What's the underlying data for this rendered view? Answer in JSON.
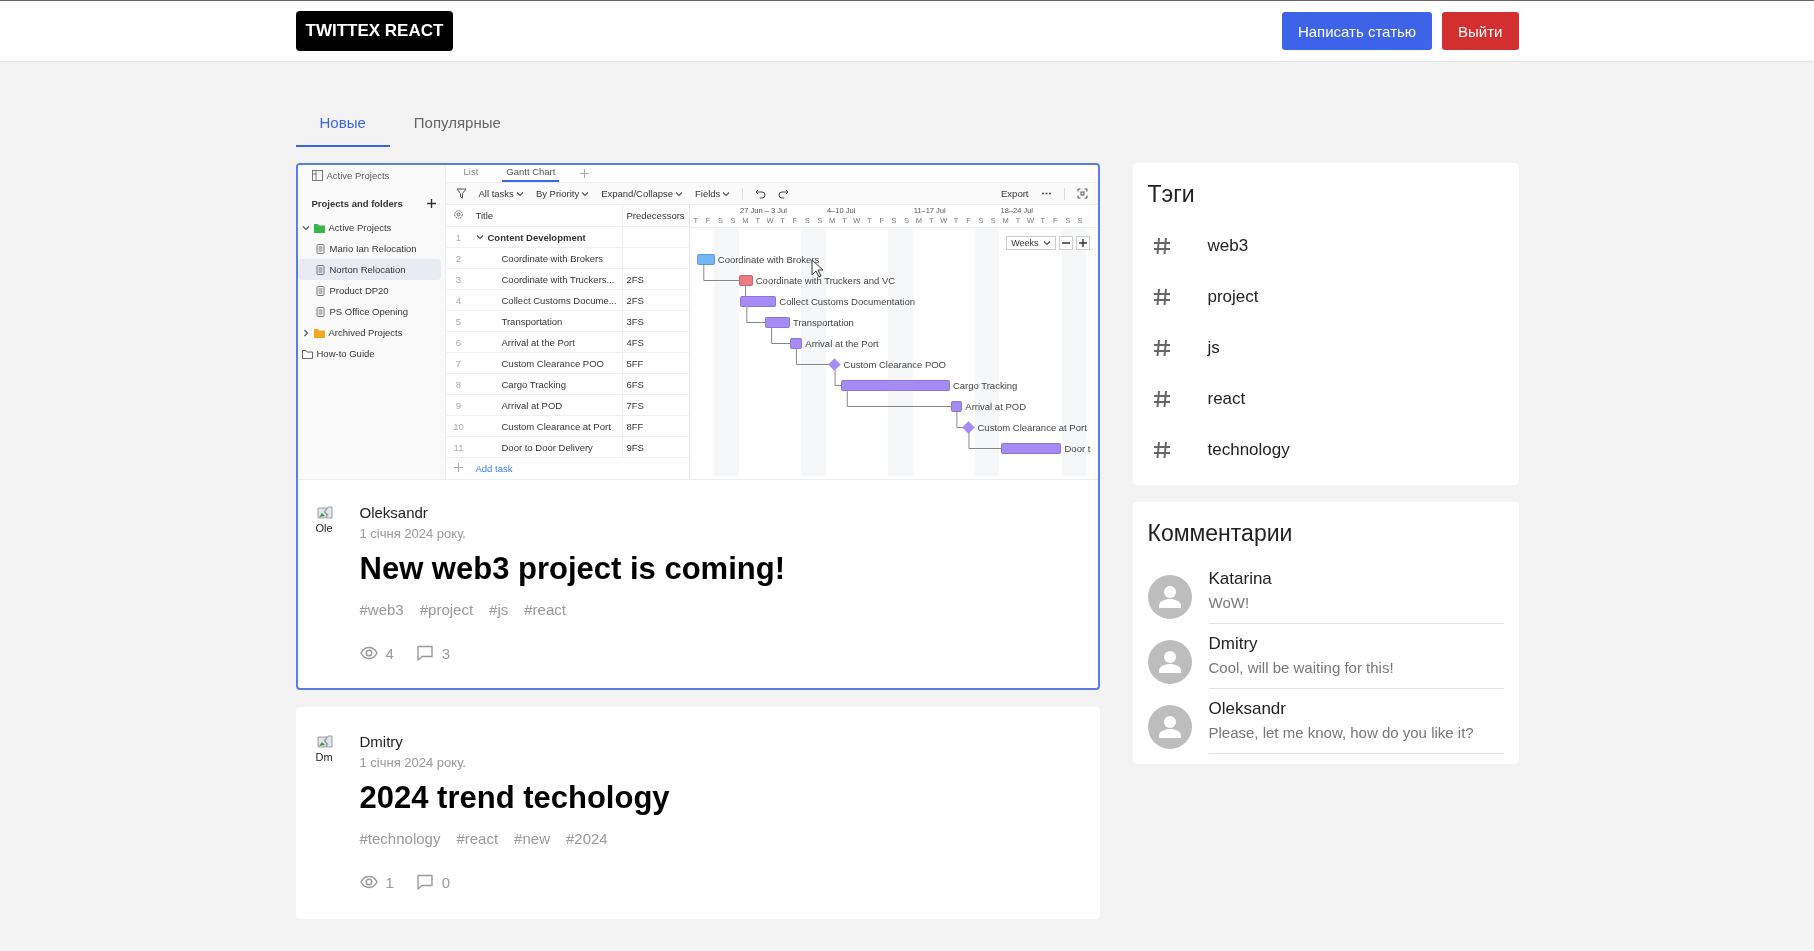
{
  "header": {
    "logo": "TWITTEX REACT",
    "buttons": [
      {
        "label": "Написать статью",
        "kind": "primary"
      },
      {
        "label": "Выйти",
        "kind": "danger"
      }
    ]
  },
  "tabs": [
    {
      "label": "Новые",
      "selected": true
    },
    {
      "label": "Популярные",
      "selected": false
    }
  ],
  "posts": [
    {
      "selected": true,
      "avatar_alt": "Ole",
      "author": "Oleksandr",
      "date": "1 січня 2024 року.",
      "title": "New web3 project is coming!",
      "tags": [
        "#web3",
        "#project",
        "#js",
        "#react"
      ],
      "views": "4",
      "comments": "3",
      "image": {
        "kind": "gantt-screenshot",
        "project_title": "Active Projects",
        "view_tabs": [
          {
            "label": "List",
            "selected": false
          },
          {
            "label": "Gantt Chart",
            "selected": true
          }
        ],
        "sidebar": {
          "title": "Projects and folders",
          "items": [
            {
              "label": "Active Projects",
              "kind": "folder",
              "color": "#3cb64a",
              "expanded": true,
              "selected": false,
              "children": [
                {
                  "label": "Mario Ian Relocation",
                  "kind": "project",
                  "selected": false
                },
                {
                  "label": "Norton Relocation",
                  "kind": "project",
                  "selected": true
                },
                {
                  "label": "Product DP20",
                  "kind": "project",
                  "selected": false
                },
                {
                  "label": "PS Office Opening",
                  "kind": "project",
                  "selected": false
                }
              ]
            },
            {
              "label": "Archived Projects",
              "kind": "folder",
              "color": "#f5a623",
              "expanded": false,
              "selected": false
            },
            {
              "label": "How-to Guide",
              "kind": "plain-folder",
              "selected": false
            }
          ]
        },
        "toolbar": [
          "All tasks",
          "By Priority",
          "Expand/Collapse",
          "Fields"
        ],
        "export": "Export",
        "columns": [
          "Title",
          "Predecessors"
        ],
        "tasks": [
          {
            "number": "1",
            "title": "Content Development",
            "kind": "group",
            "expanded": true
          },
          {
            "number": "2",
            "title": "Coordinate with Brokers",
            "kind": "task",
            "bar": {
              "kind": "task",
              "color": "#74b6fb",
              "label": "Coordinate with Brokers"
            }
          },
          {
            "number": "3",
            "title": "Coordinate with Truckers...",
            "predecessors": "2FS",
            "kind": "task",
            "bar": {
              "kind": "task",
              "color": "#ec7a80",
              "label": "Coordinate with Truckers and VC"
            }
          },
          {
            "number": "4",
            "title": "Collect Customs Docume...",
            "predecessors": "2FS",
            "kind": "task",
            "bar": {
              "kind": "task",
              "color": "#a68bf5",
              "label": "Collect Customs Documentation"
            }
          },
          {
            "number": "5",
            "title": "Transportation",
            "predecessors": "3FS",
            "kind": "task",
            "bar": {
              "kind": "task",
              "color": "#a68bf5",
              "label": "Transportation"
            }
          },
          {
            "number": "6",
            "title": "Arrival at the Port",
            "predecessors": "4FS",
            "kind": "task",
            "bar": {
              "kind": "task",
              "color": "#a68bf5",
              "label": "Arrival at the Port"
            }
          },
          {
            "number": "7",
            "title": "Custom Clearance POO",
            "predecessors": "5FF",
            "kind": "task",
            "bar": {
              "kind": "milestone",
              "color": "#a68bf5",
              "label": "Custom Clearance POO"
            }
          },
          {
            "number": "8",
            "title": "Cargo Tracking",
            "predecessors": "6FS",
            "kind": "task",
            "bar": {
              "kind": "task",
              "color": "#a68bf5",
              "label": "Cargo Tracking"
            }
          },
          {
            "number": "9",
            "title": "Arrival at POD",
            "predecessors": "7FS",
            "kind": "task",
            "bar": {
              "kind": "task",
              "color": "#a68bf5",
              "label": "Arrival at POD"
            }
          },
          {
            "number": "10",
            "title": "Custom Clearance at Port",
            "predecessors": "8FF",
            "kind": "task",
            "bar": {
              "kind": "milestone",
              "color": "#a68bf5",
              "label": "Custom Clearance at Port"
            }
          },
          {
            "number": "11",
            "title": "Door to Door Delivery",
            "predecessors": "9FS",
            "kind": "task",
            "bar": {
              "kind": "task",
              "color": "#a68bf5",
              "label": "Door t"
            }
          }
        ],
        "add_task": "Add task",
        "weeks": [
          "27 Jun – 3 Jul",
          "4–10 Jul",
          "11–17 Jul",
          "18–24 Jul"
        ],
        "days": [
          "T",
          "F",
          "S",
          "S",
          "M",
          "T",
          "W",
          "T",
          "F",
          "S",
          "S",
          "M",
          "T",
          "W",
          "T",
          "F",
          "S",
          "S",
          "M",
          "T",
          "W",
          "T",
          "F",
          "S",
          "S",
          "M",
          "T",
          "W",
          "T",
          "F",
          "S",
          "S"
        ],
        "scale": "Weeks"
      }
    },
    {
      "selected": false,
      "avatar_alt": "Dm",
      "author": "Dmitry",
      "date": "1 січня 2024 року.",
      "title": "2024 trend techology",
      "tags": [
        "#technology",
        "#react",
        "#new",
        "#2024"
      ],
      "views": "1",
      "comments": "0"
    }
  ],
  "tags_panel": {
    "title": "Тэги",
    "items": [
      "web3",
      "project",
      "js",
      "react",
      "technology"
    ]
  },
  "comments_panel": {
    "title": "Комментарии",
    "items": [
      {
        "author": "Katarina",
        "text": "WoW!"
      },
      {
        "author": "Dmitry",
        "text": "Cool, will be waiting for this!"
      },
      {
        "author": "Oleksandr",
        "text": "Please, let me know, how do you like it?"
      }
    ]
  }
}
